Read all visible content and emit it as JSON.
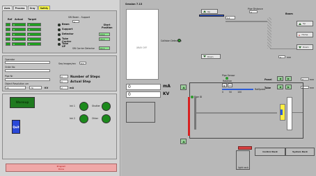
{
  "tabs": [
    "Axes",
    "Process",
    "Xray",
    "Safety"
  ],
  "axes": {
    "headers": {
      "ref": "Ref",
      "actual": "Actual",
      "target": "Target"
    },
    "rows": [
      {
        "ref": "0",
        "actual": "0",
        "target": "0",
        "name": "Beam",
        "start": ""
      },
      {
        "ref": "0",
        "actual": "0",
        "target": "0",
        "name": "Support",
        "start": ""
      },
      {
        "ref": "0",
        "actual": "0",
        "target": "0",
        "name": "Detector",
        "start": "13.4"
      },
      {
        "ref": "0",
        "actual": "0",
        "target": "0",
        "name": "Tube Carrier",
        "start": "33.3"
      },
      {
        "ref": "0",
        "actual": "0",
        "target": "0",
        "name": "Tube UP",
        "start": "11.1"
      }
    ],
    "sw_beam_support": "SW Beam - Support",
    "sw_beam_val": "0",
    "start_position": "Start Position",
    "sw_carrier_detector": "SW Carrier Detector",
    "sw_carrier_val": "11.1"
  },
  "process": {
    "operator": "Operator",
    "order_no": "Order No",
    "pipe_nr": "Pipe Nr",
    "seq_images": "Seq Images/rev",
    "seq_images_val": "0.1",
    "object_resolution": "Object Resolution um",
    "res_val": "90",
    "kv_val": "70",
    "kv_unit": "KV",
    "ma_val": "2",
    "ma_unit": "mA",
    "steps_val": "0",
    "steps_label": "Number of Steps",
    "actual_step_val": "0",
    "actual_step_label": "Actual Step"
  },
  "warmup": "Warmup",
  "ink1": "Ink 1",
  "ink2": "Ink 2",
  "shutter": "Shutter",
  "other": "Other",
  "quit": "Quit",
  "program_status": "Program\nDone",
  "right": {
    "session": "Session 7.13",
    "xray_off": "XRAY OFF",
    "up": "Up",
    "down": "Down",
    "up_val": "6.4",
    "pipe_distance": "Pipe Distance",
    "pipe_distance_val": "0",
    "boom": "Boom",
    "boom_up": "Up",
    "home": "Home",
    "boom_down": "Down",
    "boom_val": "0",
    "boom_unit": "mm",
    "collision": "Collision Detection",
    "ma_val": "0",
    "ma_unit": "mA",
    "kv_val": "0",
    "kv_unit": "KV",
    "pipe_sensor": "Pipe Sensor",
    "rotation": "Rotation",
    "pipe_id": "Pipe ID",
    "rotspeed": "RotSpeed",
    "scale": [
      "0",
      "50",
      "100"
    ],
    "panel": "Panel",
    "panel_val": "0",
    "tube": "Tube",
    "tube_val": "0",
    "unit_mm": "mm",
    "control_rack": "Control Rack",
    "system_rack": "System Rack",
    "light_rack": "light rack"
  }
}
